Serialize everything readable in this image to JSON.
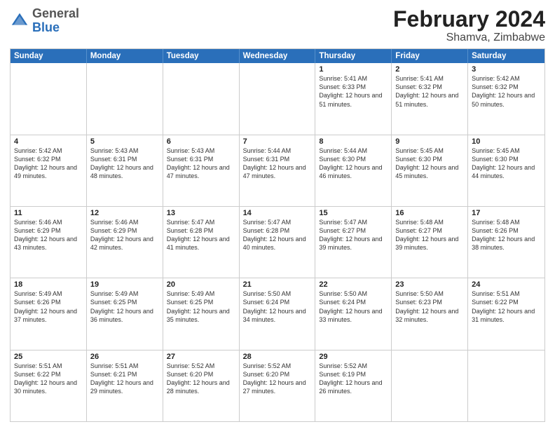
{
  "header": {
    "logo": {
      "general": "General",
      "blue": "Blue"
    },
    "title": "February 2024",
    "location": "Shamva, Zimbabwe"
  },
  "days_of_week": [
    "Sunday",
    "Monday",
    "Tuesday",
    "Wednesday",
    "Thursday",
    "Friday",
    "Saturday"
  ],
  "weeks": [
    [
      {
        "day": "",
        "sunrise": "",
        "sunset": "",
        "daylight": ""
      },
      {
        "day": "",
        "sunrise": "",
        "sunset": "",
        "daylight": ""
      },
      {
        "day": "",
        "sunrise": "",
        "sunset": "",
        "daylight": ""
      },
      {
        "day": "",
        "sunrise": "",
        "sunset": "",
        "daylight": ""
      },
      {
        "day": "1",
        "sunrise": "Sunrise: 5:41 AM",
        "sunset": "Sunset: 6:33 PM",
        "daylight": "Daylight: 12 hours and 51 minutes."
      },
      {
        "day": "2",
        "sunrise": "Sunrise: 5:41 AM",
        "sunset": "Sunset: 6:32 PM",
        "daylight": "Daylight: 12 hours and 51 minutes."
      },
      {
        "day": "3",
        "sunrise": "Sunrise: 5:42 AM",
        "sunset": "Sunset: 6:32 PM",
        "daylight": "Daylight: 12 hours and 50 minutes."
      }
    ],
    [
      {
        "day": "4",
        "sunrise": "Sunrise: 5:42 AM",
        "sunset": "Sunset: 6:32 PM",
        "daylight": "Daylight: 12 hours and 49 minutes."
      },
      {
        "day": "5",
        "sunrise": "Sunrise: 5:43 AM",
        "sunset": "Sunset: 6:31 PM",
        "daylight": "Daylight: 12 hours and 48 minutes."
      },
      {
        "day": "6",
        "sunrise": "Sunrise: 5:43 AM",
        "sunset": "Sunset: 6:31 PM",
        "daylight": "Daylight: 12 hours and 47 minutes."
      },
      {
        "day": "7",
        "sunrise": "Sunrise: 5:44 AM",
        "sunset": "Sunset: 6:31 PM",
        "daylight": "Daylight: 12 hours and 47 minutes."
      },
      {
        "day": "8",
        "sunrise": "Sunrise: 5:44 AM",
        "sunset": "Sunset: 6:30 PM",
        "daylight": "Daylight: 12 hours and 46 minutes."
      },
      {
        "day": "9",
        "sunrise": "Sunrise: 5:45 AM",
        "sunset": "Sunset: 6:30 PM",
        "daylight": "Daylight: 12 hours and 45 minutes."
      },
      {
        "day": "10",
        "sunrise": "Sunrise: 5:45 AM",
        "sunset": "Sunset: 6:30 PM",
        "daylight": "Daylight: 12 hours and 44 minutes."
      }
    ],
    [
      {
        "day": "11",
        "sunrise": "Sunrise: 5:46 AM",
        "sunset": "Sunset: 6:29 PM",
        "daylight": "Daylight: 12 hours and 43 minutes."
      },
      {
        "day": "12",
        "sunrise": "Sunrise: 5:46 AM",
        "sunset": "Sunset: 6:29 PM",
        "daylight": "Daylight: 12 hours and 42 minutes."
      },
      {
        "day": "13",
        "sunrise": "Sunrise: 5:47 AM",
        "sunset": "Sunset: 6:28 PM",
        "daylight": "Daylight: 12 hours and 41 minutes."
      },
      {
        "day": "14",
        "sunrise": "Sunrise: 5:47 AM",
        "sunset": "Sunset: 6:28 PM",
        "daylight": "Daylight: 12 hours and 40 minutes."
      },
      {
        "day": "15",
        "sunrise": "Sunrise: 5:47 AM",
        "sunset": "Sunset: 6:27 PM",
        "daylight": "Daylight: 12 hours and 39 minutes."
      },
      {
        "day": "16",
        "sunrise": "Sunrise: 5:48 AM",
        "sunset": "Sunset: 6:27 PM",
        "daylight": "Daylight: 12 hours and 39 minutes."
      },
      {
        "day": "17",
        "sunrise": "Sunrise: 5:48 AM",
        "sunset": "Sunset: 6:26 PM",
        "daylight": "Daylight: 12 hours and 38 minutes."
      }
    ],
    [
      {
        "day": "18",
        "sunrise": "Sunrise: 5:49 AM",
        "sunset": "Sunset: 6:26 PM",
        "daylight": "Daylight: 12 hours and 37 minutes."
      },
      {
        "day": "19",
        "sunrise": "Sunrise: 5:49 AM",
        "sunset": "Sunset: 6:25 PM",
        "daylight": "Daylight: 12 hours and 36 minutes."
      },
      {
        "day": "20",
        "sunrise": "Sunrise: 5:49 AM",
        "sunset": "Sunset: 6:25 PM",
        "daylight": "Daylight: 12 hours and 35 minutes."
      },
      {
        "day": "21",
        "sunrise": "Sunrise: 5:50 AM",
        "sunset": "Sunset: 6:24 PM",
        "daylight": "Daylight: 12 hours and 34 minutes."
      },
      {
        "day": "22",
        "sunrise": "Sunrise: 5:50 AM",
        "sunset": "Sunset: 6:24 PM",
        "daylight": "Daylight: 12 hours and 33 minutes."
      },
      {
        "day": "23",
        "sunrise": "Sunrise: 5:50 AM",
        "sunset": "Sunset: 6:23 PM",
        "daylight": "Daylight: 12 hours and 32 minutes."
      },
      {
        "day": "24",
        "sunrise": "Sunrise: 5:51 AM",
        "sunset": "Sunset: 6:22 PM",
        "daylight": "Daylight: 12 hours and 31 minutes."
      }
    ],
    [
      {
        "day": "25",
        "sunrise": "Sunrise: 5:51 AM",
        "sunset": "Sunset: 6:22 PM",
        "daylight": "Daylight: 12 hours and 30 minutes."
      },
      {
        "day": "26",
        "sunrise": "Sunrise: 5:51 AM",
        "sunset": "Sunset: 6:21 PM",
        "daylight": "Daylight: 12 hours and 29 minutes."
      },
      {
        "day": "27",
        "sunrise": "Sunrise: 5:52 AM",
        "sunset": "Sunset: 6:20 PM",
        "daylight": "Daylight: 12 hours and 28 minutes."
      },
      {
        "day": "28",
        "sunrise": "Sunrise: 5:52 AM",
        "sunset": "Sunset: 6:20 PM",
        "daylight": "Daylight: 12 hours and 27 minutes."
      },
      {
        "day": "29",
        "sunrise": "Sunrise: 5:52 AM",
        "sunset": "Sunset: 6:19 PM",
        "daylight": "Daylight: 12 hours and 26 minutes."
      },
      {
        "day": "",
        "sunrise": "",
        "sunset": "",
        "daylight": ""
      },
      {
        "day": "",
        "sunrise": "",
        "sunset": "",
        "daylight": ""
      }
    ]
  ]
}
